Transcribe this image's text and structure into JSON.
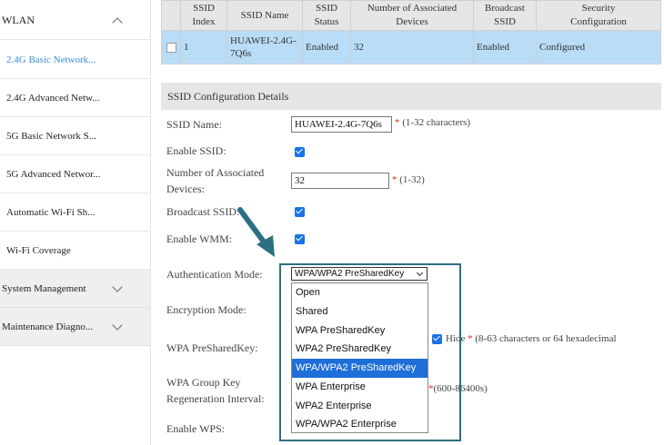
{
  "sidebar": {
    "section": "WLAN",
    "items": [
      {
        "label": "2.4G Basic Network..."
      },
      {
        "label": "2.4G Advanced Netw..."
      },
      {
        "label": "5G Basic Network S..."
      },
      {
        "label": "5G Advanced Networ..."
      },
      {
        "label": "Automatic Wi-Fi Sh..."
      },
      {
        "label": "Wi-Fi Coverage"
      }
    ],
    "groups": [
      {
        "label": "System Management"
      },
      {
        "label": "Maintenance Diagno..."
      }
    ]
  },
  "ssid_table": {
    "headers": [
      "SSID\nIndex",
      "SSID Name",
      "SSID\nStatus",
      "Number of Associated\nDevices",
      "Broadcast\nSSID",
      "Security\nConfiguration"
    ],
    "row": {
      "index": "1",
      "name": "HUAWEI-2.4G-7Q6s",
      "status": "Enabled",
      "devices": "32",
      "broadcast": "Enabled",
      "security": "Configured"
    }
  },
  "details": {
    "title": "SSID Configuration Details",
    "ssid_name_label": "SSID Name:",
    "ssid_name_value": "HUAWEI-2.4G-7Q6s",
    "ssid_name_hint": "(1-32 characters)",
    "enable_ssid_label": "Enable SSID:",
    "assoc_label_1": "Number of Associated",
    "assoc_label_2": "Devices:",
    "assoc_value": "32",
    "assoc_hint": "(1-32)",
    "broadcast_label": "Broadcast SSID:",
    "wmm_label": "Enable WMM:",
    "auth_label": "Authentication Mode:",
    "auth_selected": "WPA/WPA2 PreSharedKey",
    "auth_options": [
      "Open",
      "Shared",
      "WPA PreSharedKey",
      "WPA2 PreSharedKey",
      "WPA/WPA2 PreSharedKey",
      "WPA Enterprise",
      "WPA2 Enterprise",
      "WPA/WPA2 Enterprise"
    ],
    "encryption_label": "Encryption Mode:",
    "psk_label": "WPA PreSharedKey:",
    "hide_label": "Hide",
    "psk_hint": "(8-63 characters or 64 hexadecimal",
    "group_key_label_1": "WPA Group Key",
    "group_key_label_2": "Regeneration Interval:",
    "group_key_hint": "(600-86400s)",
    "wps_label": "Enable WPS:",
    "required_mark": "*"
  },
  "colors": {
    "accent": "#1e6fd9",
    "highlight_box": "#2c6f82",
    "row_selected": "#b9dcf7"
  }
}
